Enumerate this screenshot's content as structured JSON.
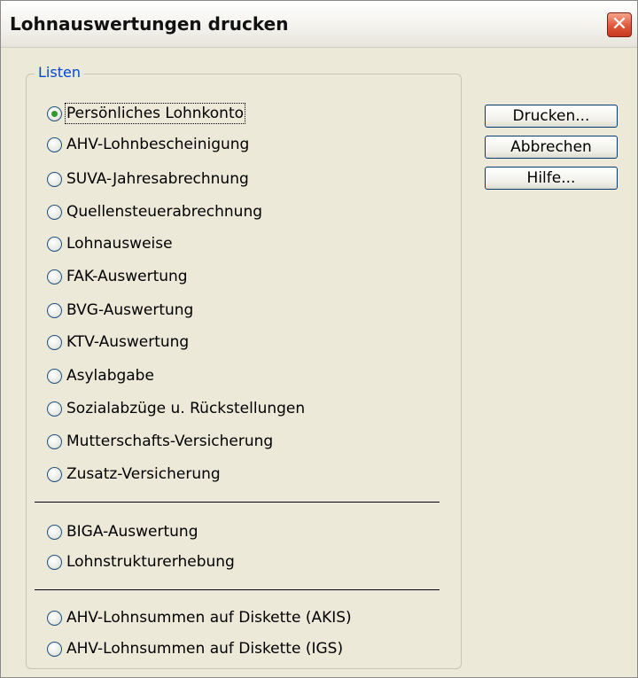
{
  "window": {
    "title": "Lohnauswertungen drucken",
    "close_symbol": "✕"
  },
  "group": {
    "label": "Listen"
  },
  "options": [
    {
      "label": "Persönliches Lohnkonto",
      "checked": true
    },
    {
      "label": "AHV-Lohnbescheinigung",
      "checked": false
    },
    {
      "label": "SUVA-Jahresabrechnung",
      "checked": false
    },
    {
      "label": "Quellensteuerabrechnung",
      "checked": false
    },
    {
      "label": "Lohnausweise",
      "checked": false
    },
    {
      "label": "FAK-Auswertung",
      "checked": false
    },
    {
      "label": "BVG-Auswertung",
      "checked": false
    },
    {
      "label": "KTV-Auswertung",
      "checked": false
    },
    {
      "label": "Asylabgabe",
      "checked": false
    },
    {
      "label": "Sozialabzüge u. Rückstellungen",
      "checked": false
    },
    {
      "label": "Mutterschafts-Versicherung",
      "checked": false
    },
    {
      "label": "Zusatz-Versicherung",
      "checked": false
    },
    {
      "label": "BIGA-Auswertung",
      "checked": false
    },
    {
      "label": "Lohnstrukturerhebung",
      "checked": false
    },
    {
      "label": "AHV-Lohnsummen auf Diskette (AKIS)",
      "checked": false
    },
    {
      "label": "AHV-Lohnsummen auf Diskette (IGS)",
      "checked": false
    }
  ],
  "buttons": {
    "print": "Drucken...",
    "cancel": "Abbrechen",
    "help": "Hilfe..."
  },
  "colors": {
    "legend": "#0046d5",
    "radio_selected": "#2f9a27",
    "close_button": "#e0573a"
  }
}
